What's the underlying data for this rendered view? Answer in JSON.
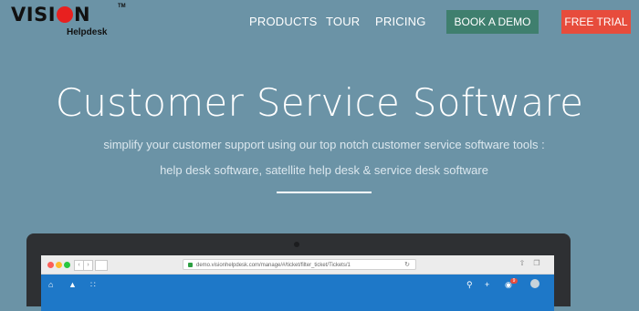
{
  "brand": {
    "name": "vision",
    "subtitle": "Helpdesk",
    "trademark": "TM"
  },
  "nav": {
    "products": "PRODUCTS",
    "tour": "TOUR",
    "pricing": "PRICING",
    "book_demo": "BOOK A DEMO",
    "free_trial": "FREE TRIAL"
  },
  "hero": {
    "title": "Customer Service Software",
    "subtitle_line1": "simplify your customer support using our top notch customer service software tools :",
    "subtitle_line2": "help desk software, satellite help desk & service desk software"
  },
  "browser": {
    "url": "demo.visionhelpdesk.com/manage/#/ticket/filter_ticket/Tickets/1",
    "notification_count": "9"
  },
  "icons": {
    "home": "home-icon",
    "upload": "upload-icon",
    "apps": "apps-grid-icon",
    "search": "search-icon",
    "add": "add-icon",
    "bell": "notification-bell-icon"
  },
  "colors": {
    "background": "#6b93a6",
    "book_demo": "#3f7f6e",
    "free_trial": "#e74c3c",
    "app_bar": "#1e78c8",
    "logo_accent": "#e8201f"
  }
}
